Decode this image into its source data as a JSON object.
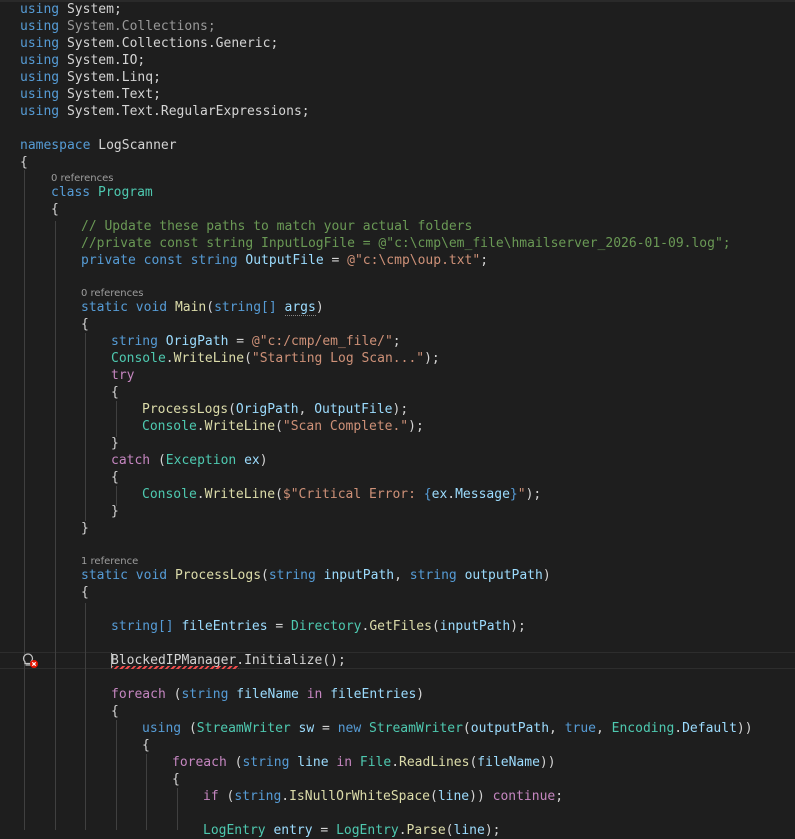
{
  "editor": {
    "usings": [
      {
        "kw": "using",
        "ns": "System",
        "end": ";"
      },
      {
        "kw": "using",
        "ns": "System.Collections",
        "end": ";"
      },
      {
        "kw": "using",
        "ns": "System.Collections.Generic",
        "end": ";"
      },
      {
        "kw": "using",
        "ns": "System.IO",
        "end": ";"
      },
      {
        "kw": "using",
        "ns": "System.Linq",
        "end": ";"
      },
      {
        "kw": "using",
        "ns": "System.Text",
        "end": ";"
      },
      {
        "kw": "using",
        "ns": "System.Text.RegularExpressions",
        "end": ";"
      }
    ],
    "namespace_kw": "namespace",
    "namespace_name": "LogScanner",
    "open_brace": "{",
    "close_brace": "}",
    "codelens": {
      "program": "0 references",
      "main": "0 references",
      "processlogs": "1 reference"
    },
    "tokens": {
      "class": "class",
      "program": "Program",
      "comment1": "// Update these paths to match your actual folders",
      "comment2": "//private const string InputLogFile = @\"c:\\cmp\\em_file\\hmailserver_2026-01-09.log\";",
      "private": "private",
      "const": "const",
      "string": "string",
      "outputfile": "OutputFile",
      "eq": " = ",
      "outputfile_val": "@\"c:\\cmp\\oup.txt\"",
      "semi": ";",
      "static": "static",
      "void": "void",
      "main": "Main",
      "lparen": "(",
      "rparen": ")",
      "string_arr": "string[]",
      "args": "args",
      "origpath": "OrigPath",
      "origpath_val": "@\"c:/cmp/em_file/\"",
      "console": "Console",
      "dot": ".",
      "writeline": "WriteLine",
      "starting": "\"Starting Log Scan...\"",
      "try": "try",
      "processlogs": "ProcessLogs",
      "comma": ", ",
      "scan_complete": "\"Scan Complete.\"",
      "catch": "catch",
      "exception": "Exception",
      "ex": "ex",
      "crit_prefix": "$\"Critical Error: ",
      "lbrace": "{",
      "rbrace": "}",
      "message": "Message",
      "quote": "\"",
      "inputpath": "inputPath",
      "outputpath": "outputPath",
      "fileentries": "fileEntries",
      "directory": "Directory",
      "getfiles": "GetFiles",
      "blockedip": "BlockedIPManager",
      "initialize": "Initialize",
      "foreach": "foreach",
      "in": "in",
      "filename": "fileName",
      "using": "using",
      "streamwriter": "StreamWriter",
      "sw": "sw",
      "new": "new",
      "true": "true",
      "encoding": "Encoding",
      "default": "Default",
      "line": "line",
      "file": "File",
      "readlines": "ReadLines",
      "if": "if",
      "isnullorwhitespace": "IsNullOrWhiteSpace",
      "continue": "continue",
      "logentry": "LogEntry",
      "entry": "entry",
      "parse": "Parse"
    }
  }
}
